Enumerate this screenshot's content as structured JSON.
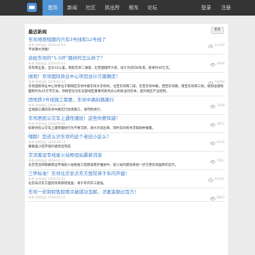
{
  "nav": {
    "logo_icon": "chat-bubble-logo",
    "items": [
      "首页",
      "新闻",
      "社区",
      "拆出所",
      "租车",
      "论坛"
    ],
    "active_index": 0,
    "login": "登录",
    "register": "注册"
  },
  "news": {
    "heading": "最近新闻",
    "more": "更多",
    "items": [
      {
        "title": "东坝地铁短期内只有3号线和12号线了",
        "meta": "东坝  东坝社区 2019-01-03",
        "views": "10128",
        "summary": "平谷镇大改版！"
      },
      {
        "title": "途经东坝的“5.5环”路修的怎么样了？",
        "meta": "东坝  东坝社区 2019-01-03",
        "views": "4946",
        "summary": "东坝南五金，全长33公里，南起京津二通道，北至国城环大道，设计为双向6车道，投资约40亿元。"
      },
      {
        "title": "围观！东坝国际商业中心项目设计方案确定！",
        "meta": "东坝  东坝社区 2019-01-03",
        "views": "10290",
        "summary": "东坝国际商业中心项目位于朝阳区东坝中部东坝乡东坝村，北至东坝南二街，东至东坝中路，西至东坝路，南至东坝南三街，规划总建筑面积约为35万平方米。项目定位为东北部地区重要的商务办公和商业综合体，提升地区产业结构。"
      },
      {
        "title": "因地铁3号线施工需要，东坝中路封路施行",
        "meta": "东坝  东坝社区 2018-11-19",
        "views": "7658",
        "summary": "全线施工期间东坝中路实行封闭施工，请市民绕行。"
      },
      {
        "title": "东坝居民公交车上遇性骚扰！这些你要知道！",
        "meta": "东坝  东坝社区 2018-09-02",
        "views": "3812",
        "summary": "如果你在公交车上遇到骚扰行为不要沉默，请大声说出来，同时向司机寻求帮助并报警。"
      },
      {
        "title": "喂鹅！您还认识东坝的这个老旧小区么？",
        "meta": "东坝  东坝社区 2018-09-13",
        "views": "6245",
        "summary": "康静里小区环境升级改造完成"
      },
      {
        "title": "京滨客运专线星火站枢纽站最新消息",
        "meta": "东坝  东坝社区 2018-07-11",
        "views": "7012",
        "summary": "北京至沈阳铁路客运专线星火站枢纽工程建设稳步推进中，星火站的建设将进一步方便东坝居民的出行。"
      },
      {
        "title": "三甲标准！东坝北京安贞东方医院将于年内开建！",
        "meta": "东坝  东坝社区 2018-03-21",
        "views": "15451",
        "summary": "北京安贞东方医院项目获得批复，将于年内开工建设。"
      },
      {
        "title": "东坝一处制假售假窝点被成功瓦解，涉案金额过百万！",
        "meta": "东坝  东坝社区 2018-02-11",
        "views": "8833",
        "summary": ""
      }
    ]
  },
  "colors": {
    "topbar": "#343434",
    "accent": "#4f91d3",
    "link": "#3a7bc8",
    "background": "#ebebeb"
  }
}
